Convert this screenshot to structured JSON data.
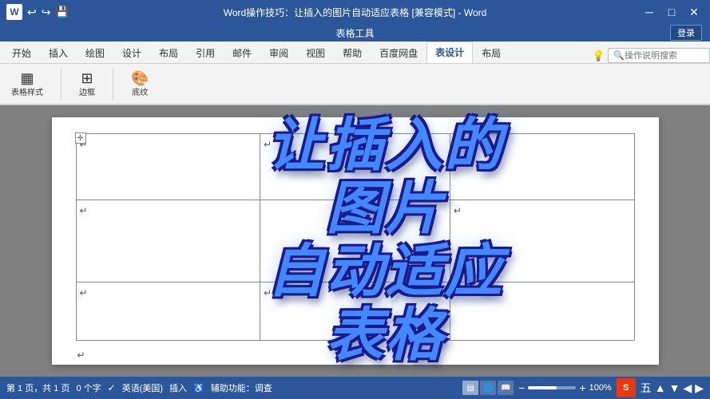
{
  "titlebar": {
    "title": "Word操作技巧：让插入的图片自动适应表格 [兼容模式] - Word",
    "app_name": "Word",
    "logo_letter": "W"
  },
  "table_tools": {
    "label": "表格工具",
    "login_btn": "登录"
  },
  "menu_tabs": [
    {
      "id": "home",
      "label": "开始",
      "active": false
    },
    {
      "id": "insert",
      "label": "插入",
      "active": false
    },
    {
      "id": "draw",
      "label": "绘图",
      "active": false
    },
    {
      "id": "design",
      "label": "设计",
      "active": false
    },
    {
      "id": "layout",
      "label": "布局",
      "active": false
    },
    {
      "id": "references",
      "label": "引用",
      "active": false
    },
    {
      "id": "mail",
      "label": "邮件",
      "active": false
    },
    {
      "id": "review",
      "label": "审阅",
      "active": false
    },
    {
      "id": "view",
      "label": "视图",
      "active": false
    },
    {
      "id": "help",
      "label": "帮助",
      "active": false
    },
    {
      "id": "baidu",
      "label": "百度网盘",
      "active": false
    },
    {
      "id": "table-design",
      "label": "表设计",
      "active": true
    },
    {
      "id": "table-layout",
      "label": "布局",
      "active": false
    }
  ],
  "ribbon": {
    "help_search_placeholder": "操作说明搜索",
    "light_icon": "💡"
  },
  "big_text": {
    "line1": "让插入的",
    "line2": "图片",
    "line3": "自动适应",
    "line4": "表格"
  },
  "status_bar": {
    "pages": "第 1 页，共 1 页",
    "chars": "0 个字",
    "language": "英语(美国)",
    "insert_mode": "插入",
    "accessibility": "辅助功能：调查",
    "zoom_percent": "100%",
    "zoom_fill_width": "60%"
  },
  "table": {
    "rows": 3,
    "cols": 3,
    "return_chars": [
      "↵",
      "↵",
      "↵",
      "↵",
      "↵",
      "↵",
      "↵",
      "↵",
      "↵",
      "↵"
    ]
  }
}
